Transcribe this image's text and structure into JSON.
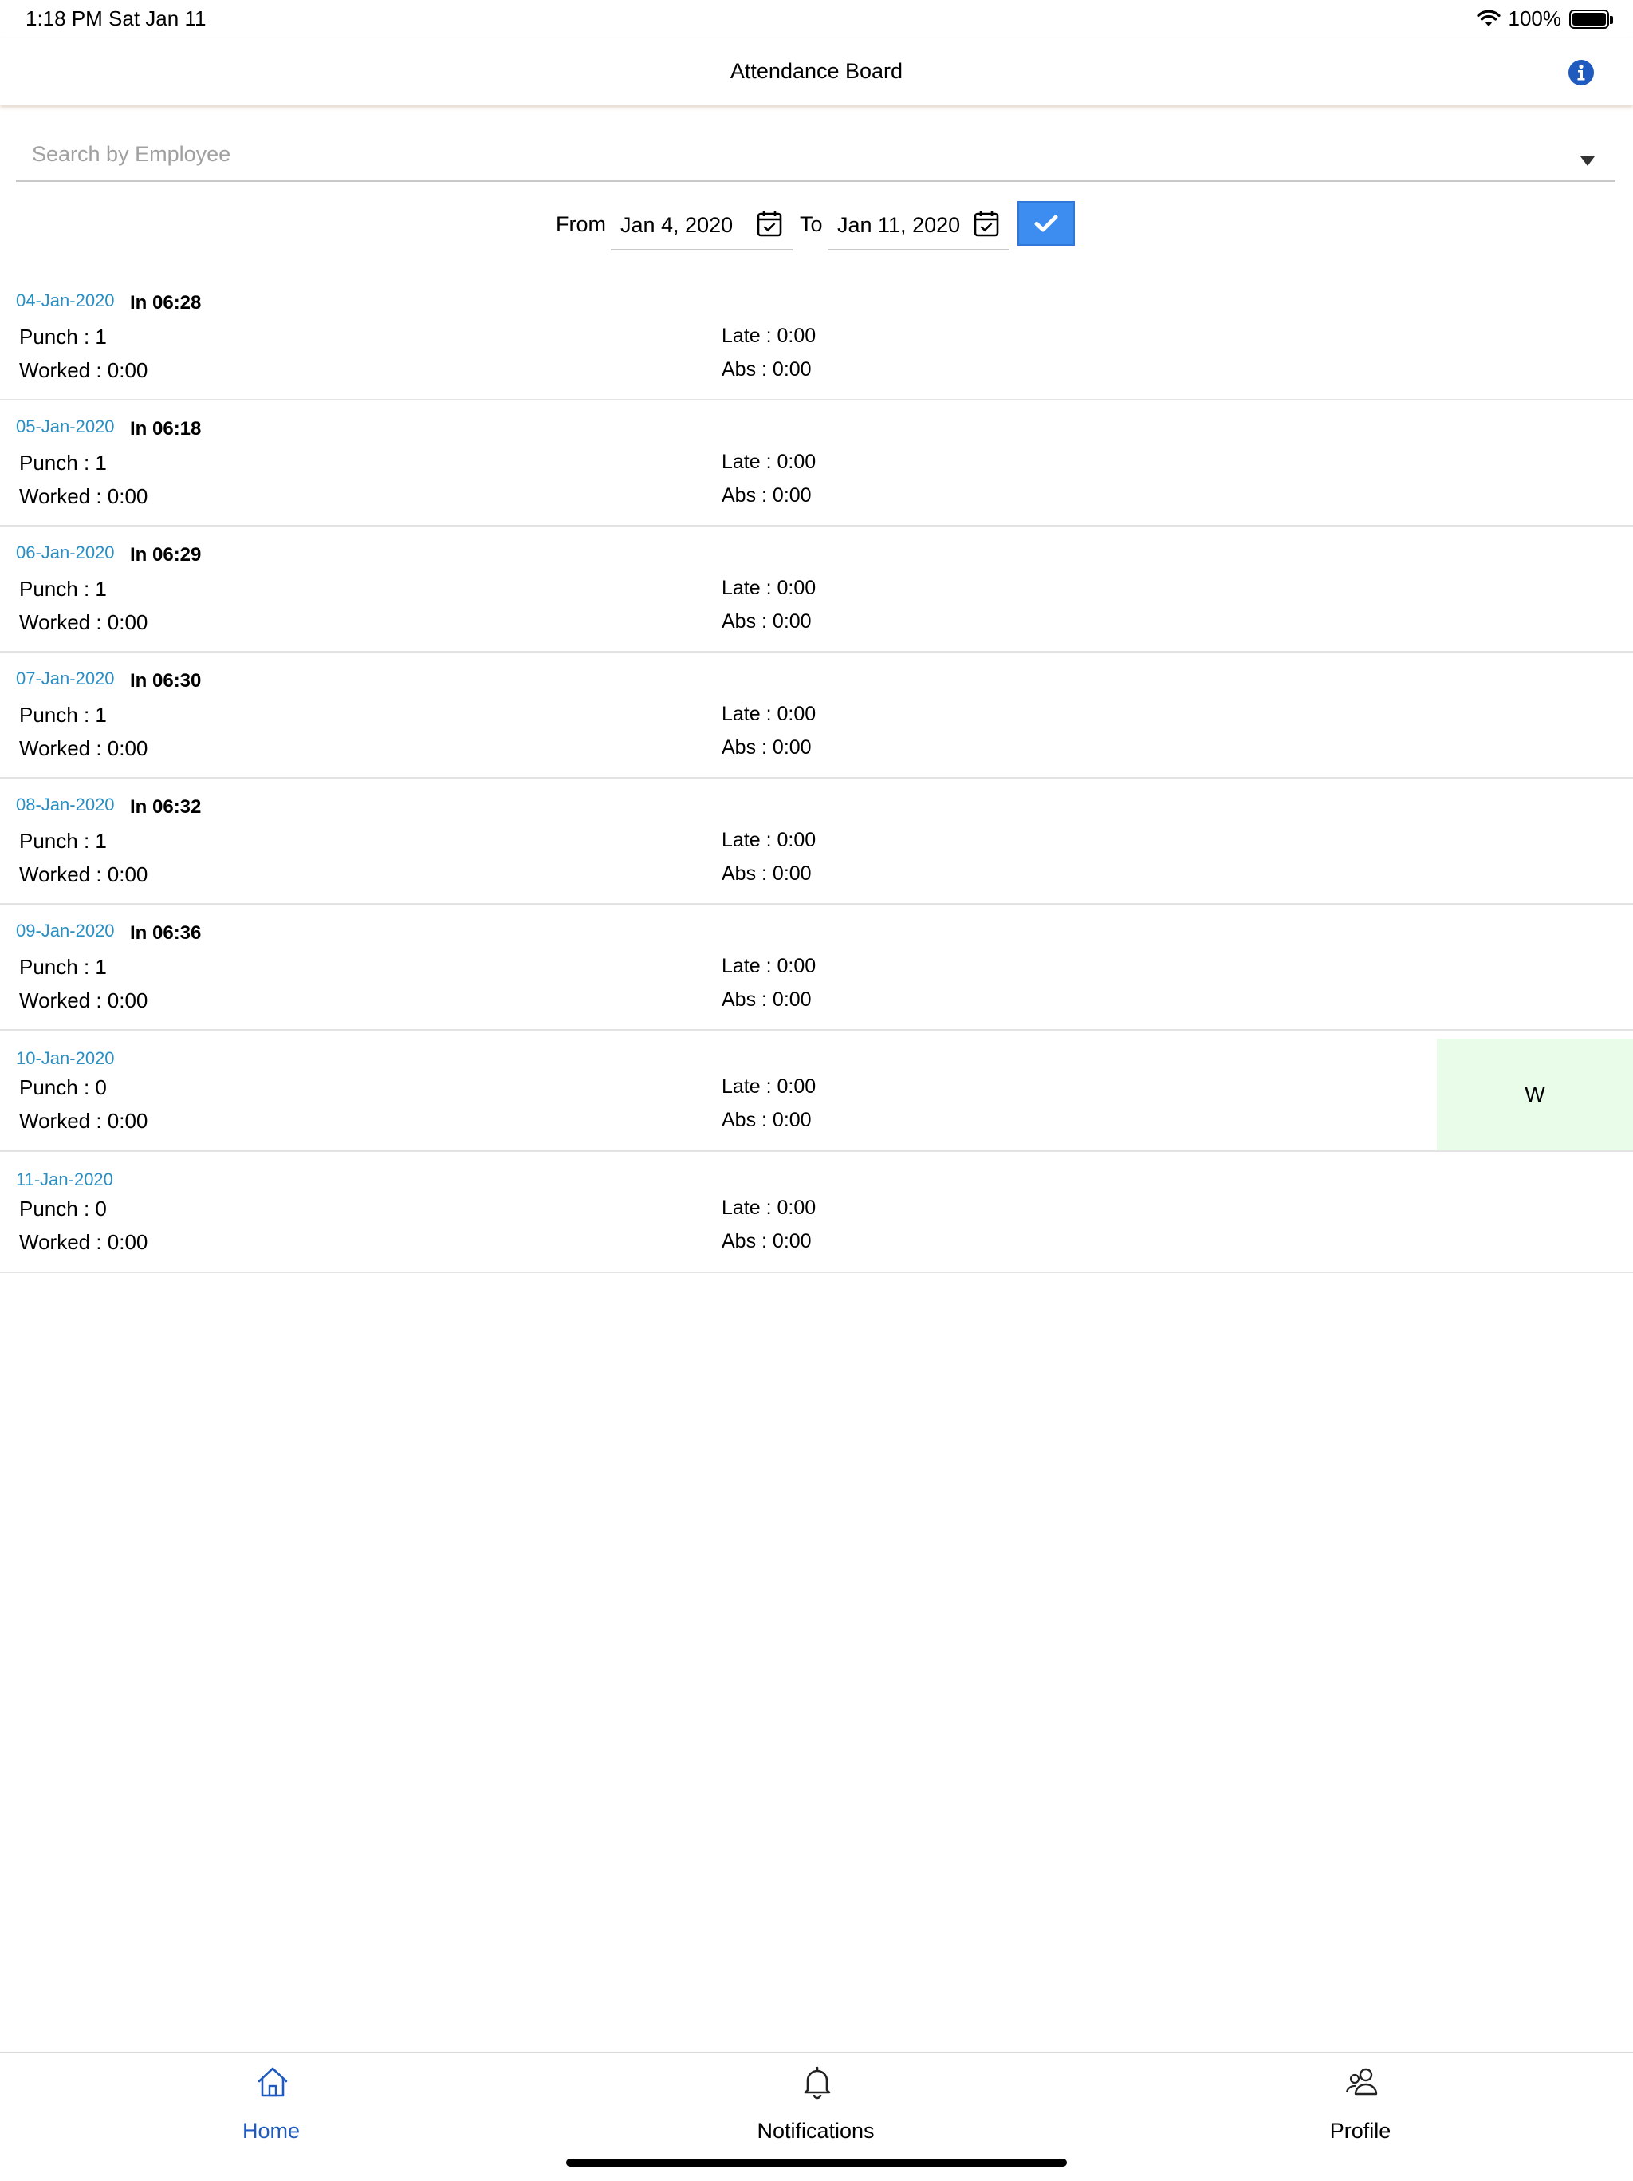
{
  "status_bar": {
    "time": "1:18 PM   Sat Jan 11",
    "battery": "100%"
  },
  "header": {
    "title": "Attendance Board",
    "info_icon": "info-circle-icon"
  },
  "search": {
    "placeholder": "Search by Employee",
    "value": ""
  },
  "date_range": {
    "from_label": "From",
    "from_value": "Jan 4, 2020",
    "to_label": "To",
    "to_value": "Jan 11, 2020"
  },
  "records": [
    {
      "date": "04-Jan-2020",
      "in": "In 06:28",
      "punch": "Punch : 1",
      "worked": "Worked : 0:00",
      "late": "Late : 0:00",
      "abs": "Abs : 0:00"
    },
    {
      "date": "05-Jan-2020",
      "in": "In 06:18",
      "punch": "Punch : 1",
      "worked": "Worked : 0:00",
      "late": "Late : 0:00",
      "abs": "Abs : 0:00"
    },
    {
      "date": "06-Jan-2020",
      "in": "In 06:29",
      "punch": "Punch : 1",
      "worked": "Worked : 0:00",
      "late": "Late : 0:00",
      "abs": "Abs : 0:00"
    },
    {
      "date": "07-Jan-2020",
      "in": "In 06:30",
      "punch": "Punch : 1",
      "worked": "Worked : 0:00",
      "late": "Late : 0:00",
      "abs": "Abs : 0:00"
    },
    {
      "date": "08-Jan-2020",
      "in": "In 06:32",
      "punch": "Punch : 1",
      "worked": "Worked : 0:00",
      "late": "Late : 0:00",
      "abs": "Abs : 0:00"
    },
    {
      "date": "09-Jan-2020",
      "in": "In 06:36",
      "punch": "Punch : 1",
      "worked": "Worked : 0:00",
      "late": "Late : 0:00",
      "abs": "Abs : 0:00"
    },
    {
      "date": "10-Jan-2020",
      "punch": "Punch : 0",
      "worked": "Worked : 0:00",
      "late": "Late : 0:00",
      "abs": "Abs : 0:00",
      "badge": "W"
    },
    {
      "date": "11-Jan-2020",
      "punch": "Punch : 0",
      "worked": "Worked : 0:00",
      "late": "Late : 0:00",
      "abs": "Abs : 0:00"
    }
  ],
  "tabs": [
    {
      "label": "Home",
      "icon": "home-icon",
      "active": true
    },
    {
      "label": "Notifications",
      "icon": "bell-icon",
      "active": false
    },
    {
      "label": "Profile",
      "icon": "users-icon",
      "active": false
    }
  ],
  "colors": {
    "accent": "#3d8cf0",
    "date_text": "#2a8fc4",
    "active_tab": "#1f5bbf",
    "weekend_badge": "#e9fbe9"
  }
}
